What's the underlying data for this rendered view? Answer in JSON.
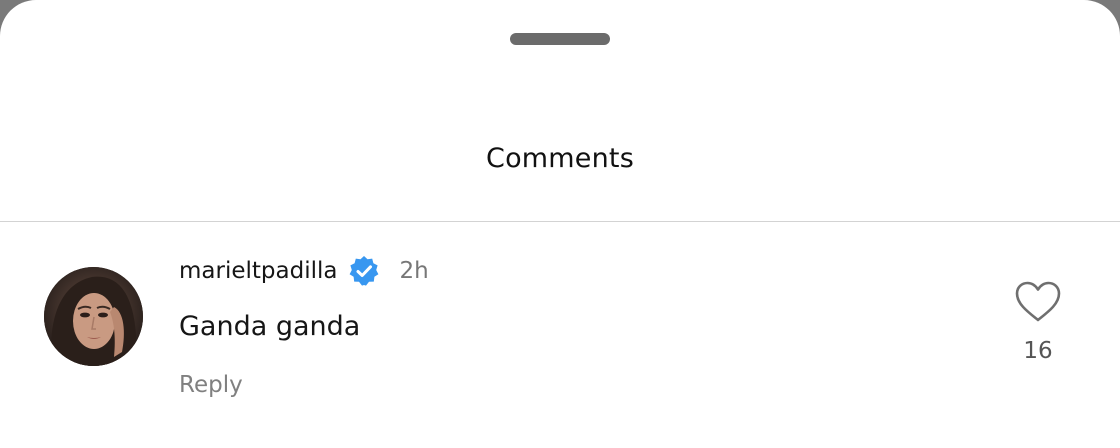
{
  "sheet": {
    "title": "Comments"
  },
  "comment": {
    "username": "marieltpadilla",
    "verified": true,
    "time": "2h",
    "text": "Ganda ganda",
    "reply_label": "Reply",
    "like_count": "16"
  },
  "icons": {
    "handle": "drag-handle",
    "verified": "verified-badge-icon",
    "like": "heart-outline-icon"
  },
  "colors": {
    "verified_badge": "#3897f0",
    "background": "#ffffff",
    "secondary_text": "#808080"
  }
}
